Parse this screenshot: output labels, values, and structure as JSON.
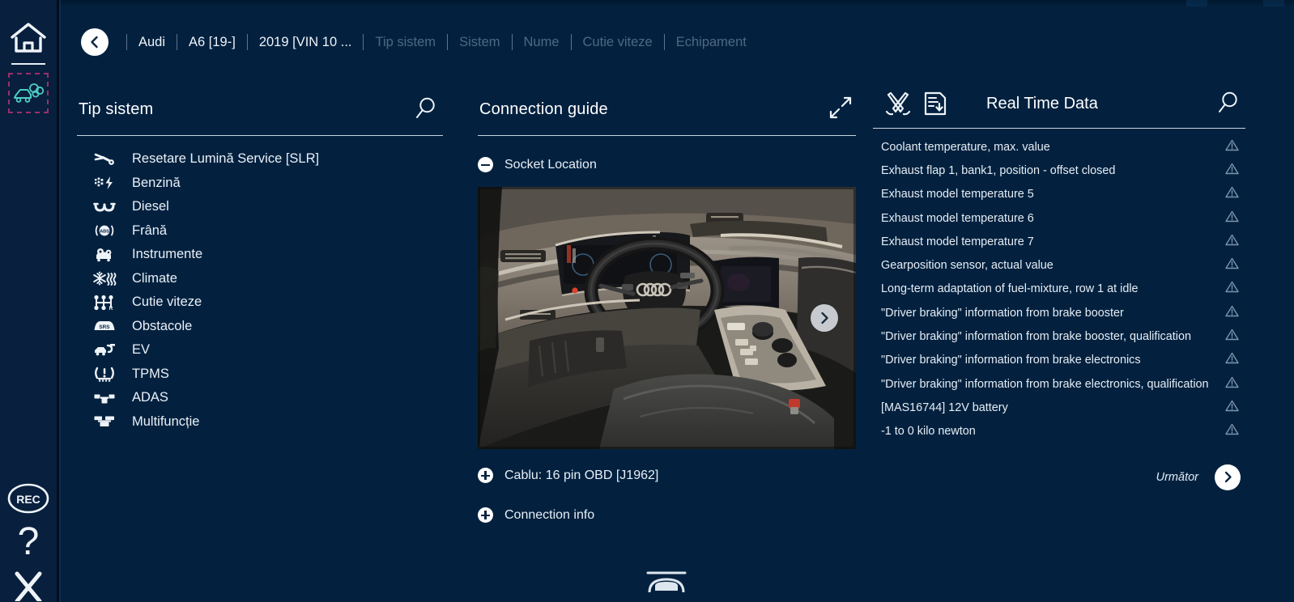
{
  "app": {
    "background": "#03213f",
    "rail_background": "#081f3d",
    "accent": "#ffffff"
  },
  "rail": {
    "items": [
      {
        "name": "home-icon",
        "label": "Home"
      },
      {
        "name": "emissions-icon",
        "label": "Emissions",
        "highlight_color": "#9b2f6b",
        "icon_color": "#4ecdc4"
      },
      {
        "name": "rec-icon",
        "label": "REC"
      },
      {
        "name": "help-icon",
        "label": "?"
      },
      {
        "name": "close-icon",
        "label": "Close"
      }
    ],
    "rec_text": "REC",
    "help_text": "?"
  },
  "breadcrumb": {
    "back_label": "Back",
    "items": [
      {
        "label": "Audi",
        "muted": false
      },
      {
        "label": "A6 [19-]",
        "muted": false
      },
      {
        "label": "2019 [VIN 10 ...",
        "muted": false
      },
      {
        "label": "Tip sistem",
        "muted": true
      },
      {
        "label": "Sistem",
        "muted": true
      },
      {
        "label": "Nume",
        "muted": true
      },
      {
        "label": "Cutie viteze",
        "muted": true
      },
      {
        "label": "Echipament",
        "muted": true
      }
    ]
  },
  "left_panel": {
    "title": "Tip sistem",
    "search_label": "Search",
    "items": [
      {
        "label": "Resetare Lumină Service [SLR]",
        "icon": "wrench-icon"
      },
      {
        "label": "Benzină",
        "icon": "petrol-engine-icon"
      },
      {
        "label": "Diesel",
        "icon": "diesel-glowplug-icon"
      },
      {
        "label": "Frână",
        "icon": "abs-brake-icon"
      },
      {
        "label": "Instrumente",
        "icon": "instrument-cluster-icon"
      },
      {
        "label": "Climate",
        "icon": "climate-icon"
      },
      {
        "label": "Cutie viteze",
        "icon": "gearbox-icon"
      },
      {
        "label": "Obstacole",
        "icon": "srs-airbag-icon"
      },
      {
        "label": "EV",
        "icon": "ev-charge-icon"
      },
      {
        "label": "TPMS",
        "icon": "tpms-icon"
      },
      {
        "label": "ADAS",
        "icon": "adas-icon"
      },
      {
        "label": "Multifuncție",
        "icon": "multifunction-icon"
      }
    ]
  },
  "center_panel": {
    "title": "Connection guide",
    "expand_label": "Expand",
    "sections": [
      {
        "label": "Socket Location",
        "state": "expanded"
      },
      {
        "label": "Cablu: 16 pin OBD [J1962]",
        "state": "collapsed"
      },
      {
        "label": "Connection info",
        "state": "collapsed"
      }
    ],
    "photo_alt": "Audi A6 interior dashboard and OBD socket location",
    "next_image_label": "Next image"
  },
  "right_panel": {
    "title": "Real Time Data",
    "tools_label": "Tools",
    "report_label": "Report",
    "search_label": "Search",
    "next_label": "Următor",
    "items": [
      {
        "label": "Coolant temperature, max. value",
        "status": "warning"
      },
      {
        "label": "Exhaust flap 1, bank1, position - offset closed",
        "status": "warning"
      },
      {
        "label": "Exhaust model temperature 5",
        "status": "warning"
      },
      {
        "label": "Exhaust model temperature 6",
        "status": "warning"
      },
      {
        "label": "Exhaust model temperature 7",
        "status": "warning"
      },
      {
        "label": "Gearposition sensor, actual value",
        "status": "warning"
      },
      {
        "label": "Long-term adaptation of fuel-mixture, row 1 at idle",
        "status": "warning"
      },
      {
        "label": "\"Driver braking\" information from brake booster",
        "status": "warning"
      },
      {
        "label": "\"Driver braking\" information from brake booster, qualification",
        "status": "warning"
      },
      {
        "label": "\"Driver braking\" information from brake electronics",
        "status": "warning"
      },
      {
        "label": "\"Driver braking\" information from brake electronics, qualification",
        "status": "warning"
      },
      {
        "label": "[MAS16744] 12V battery",
        "status": "warning"
      },
      {
        "label": "-1 to 0 kilo newton",
        "status": "warning"
      }
    ]
  },
  "bottom": {
    "vehicle_icon": "vehicle-icon"
  }
}
